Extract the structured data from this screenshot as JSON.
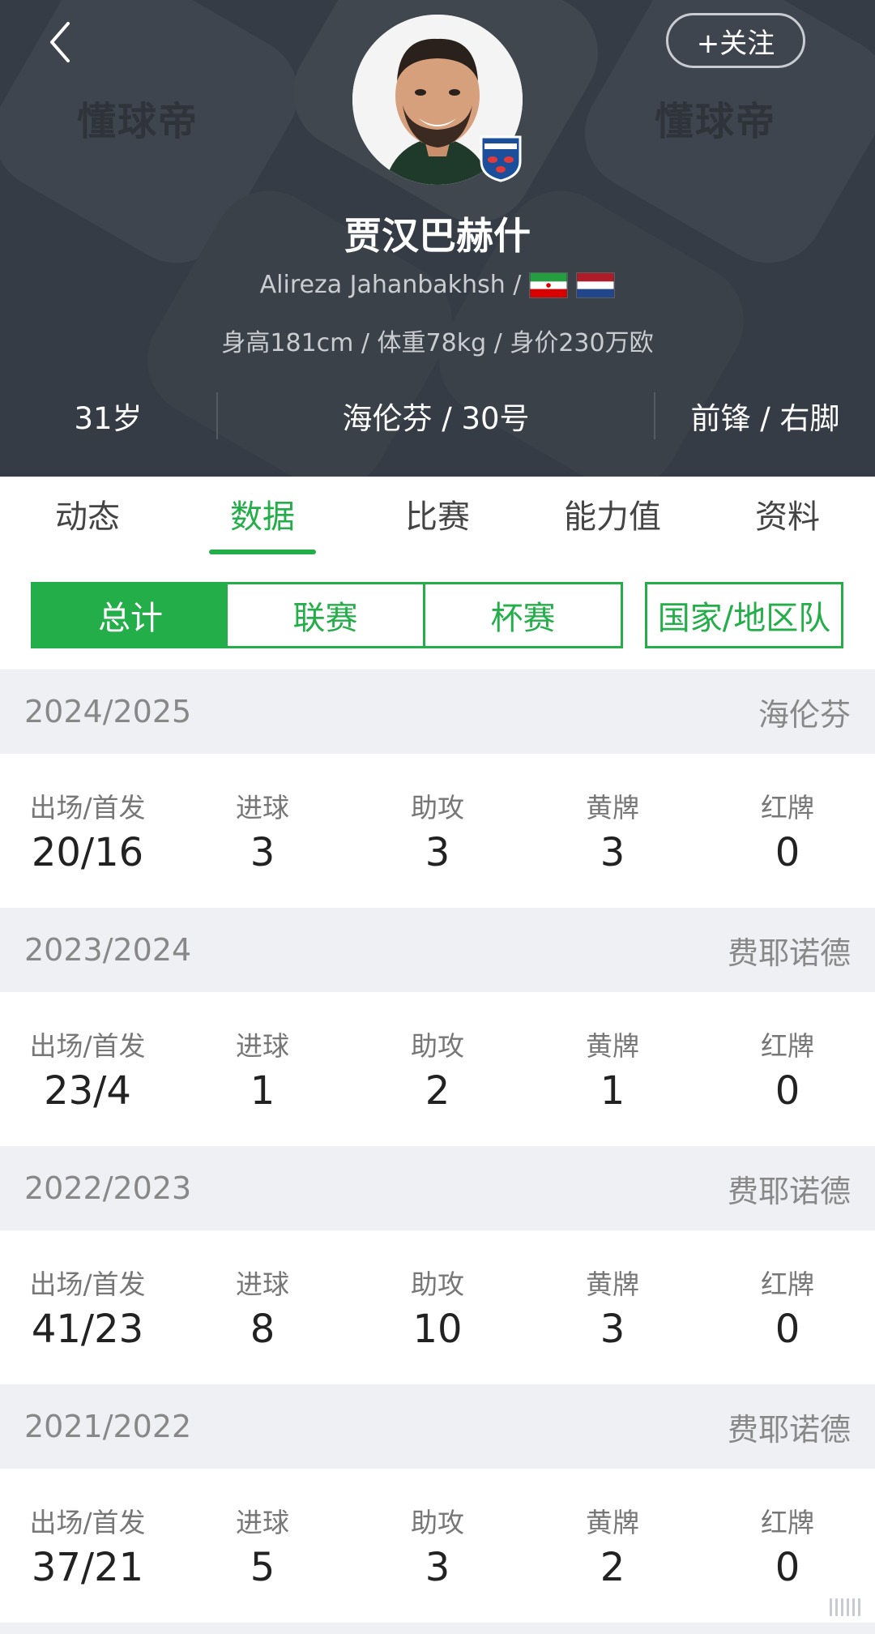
{
  "header": {
    "watermark": "懂球帝",
    "follow_label": "+关注",
    "player_name": "贾汉巴赫什",
    "latin_name": "Alireza Jahanbakhsh /",
    "physical": "身高181cm / 体重78kg / 身价230万欧",
    "age": "31岁",
    "club_number": "海伦芬 / 30号",
    "position_foot": "前锋 / 右脚",
    "flags": [
      "iran-flag",
      "netherlands-flag"
    ]
  },
  "tabs": [
    {
      "label": "动态"
    },
    {
      "label": "数据"
    },
    {
      "label": "比赛"
    },
    {
      "label": "能力值"
    },
    {
      "label": "资料"
    }
  ],
  "active_tab": "数据",
  "filters": [
    {
      "label": "总计"
    },
    {
      "label": "联赛"
    },
    {
      "label": "杯赛"
    },
    {
      "label": "国家/地区队"
    }
  ],
  "active_filter": "总计",
  "stat_labels": [
    "出场/首发",
    "进球",
    "助攻",
    "黄牌",
    "红牌"
  ],
  "seasons": [
    {
      "year": "2024/2025",
      "club": "海伦芬",
      "values": [
        "20/16",
        "3",
        "3",
        "3",
        "0"
      ]
    },
    {
      "year": "2023/2024",
      "club": "费耶诺德",
      "values": [
        "23/4",
        "1",
        "2",
        "1",
        "0"
      ]
    },
    {
      "year": "2022/2023",
      "club": "费耶诺德",
      "values": [
        "41/23",
        "8",
        "10",
        "3",
        "0"
      ]
    },
    {
      "year": "2021/2022",
      "club": "费耶诺德",
      "values": [
        "37/21",
        "5",
        "3",
        "2",
        "0"
      ]
    }
  ],
  "colors": {
    "accent": "#24ae4a",
    "header_bg": "#363c45",
    "section_bg": "#eef0f3"
  }
}
